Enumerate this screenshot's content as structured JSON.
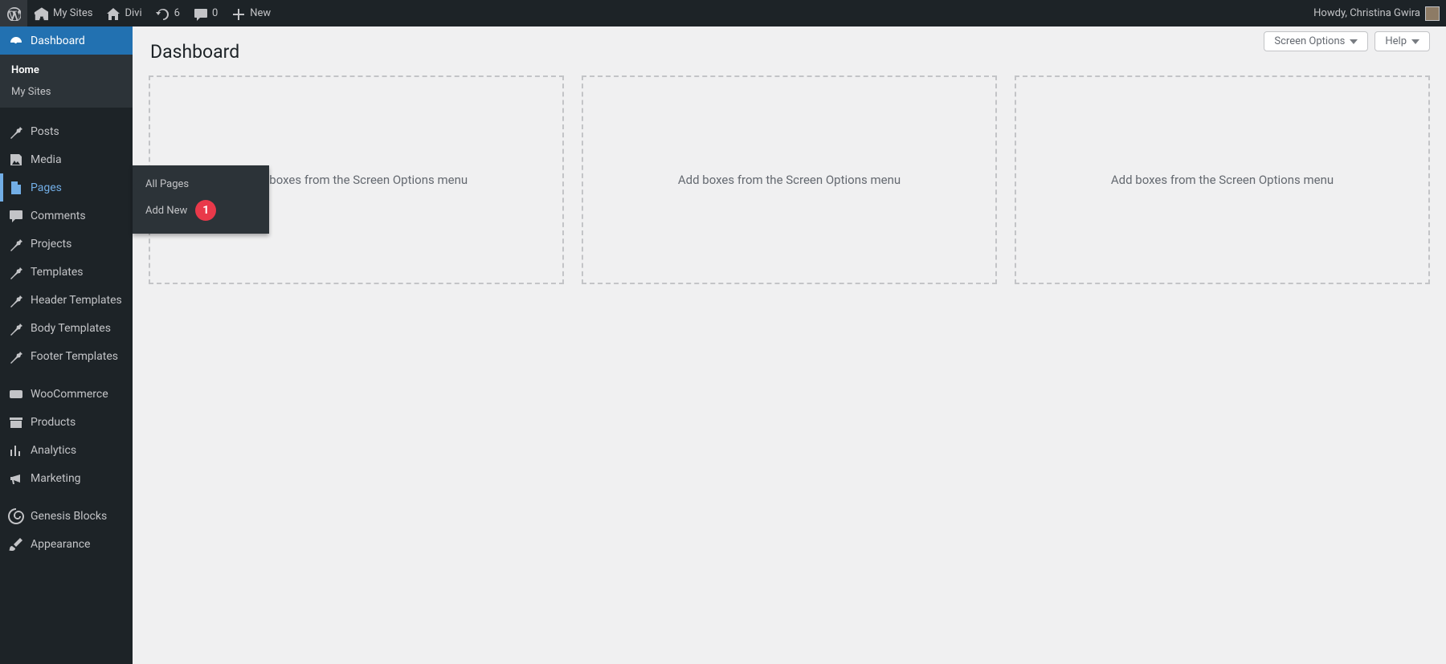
{
  "adminbar": {
    "my_sites": "My Sites",
    "site_name": "Divi",
    "updates_count": "6",
    "comments_count": "0",
    "new_label": "New",
    "howdy": "Howdy, Christina Gwira"
  },
  "sidebar": {
    "dashboard": {
      "label": "Dashboard",
      "sub_home": "Home",
      "sub_mysites": "My Sites"
    },
    "pages_flyout": {
      "all_pages": "All Pages",
      "add_new": "Add New",
      "badge": "1"
    },
    "items": [
      {
        "key": "posts",
        "label": "Posts",
        "icon": "pin"
      },
      {
        "key": "media",
        "label": "Media",
        "icon": "media"
      },
      {
        "key": "pages",
        "label": "Pages",
        "icon": "page",
        "open": true
      },
      {
        "key": "comments",
        "label": "Comments",
        "icon": "comment"
      },
      {
        "key": "projects",
        "label": "Projects",
        "icon": "pin"
      },
      {
        "key": "templates",
        "label": "Templates",
        "icon": "pin"
      },
      {
        "key": "header_templates",
        "label": "Header Templates",
        "icon": "pin"
      },
      {
        "key": "body_templates",
        "label": "Body Templates",
        "icon": "pin"
      },
      {
        "key": "footer_templates",
        "label": "Footer Templates",
        "icon": "pin"
      }
    ],
    "items2": [
      {
        "key": "woocommerce",
        "label": "WooCommerce",
        "icon": "woo"
      },
      {
        "key": "products",
        "label": "Products",
        "icon": "archive"
      },
      {
        "key": "analytics",
        "label": "Analytics",
        "icon": "bars"
      },
      {
        "key": "marketing",
        "label": "Marketing",
        "icon": "megaphone"
      }
    ],
    "items3": [
      {
        "key": "genesis_blocks",
        "label": "Genesis Blocks",
        "icon": "swirl"
      },
      {
        "key": "appearance",
        "label": "Appearance",
        "icon": "brush"
      }
    ]
  },
  "main": {
    "title": "Dashboard",
    "screen_options": "Screen Options",
    "help": "Help",
    "placeholder": "Add boxes from the Screen Options menu"
  }
}
